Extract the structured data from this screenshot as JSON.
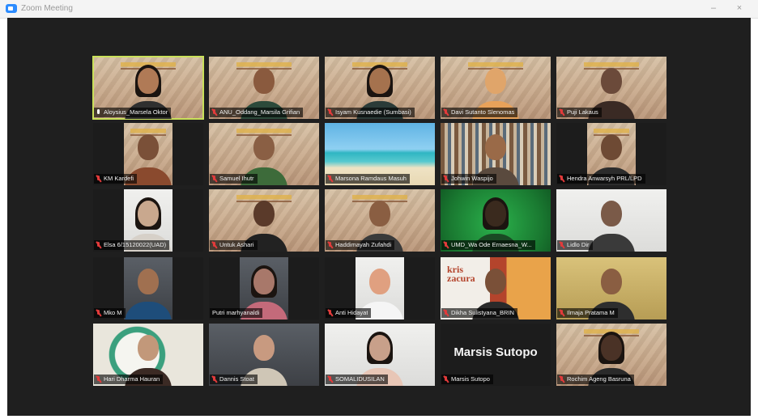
{
  "window": {
    "title": "Zoom Meeting",
    "minimize_label": "–",
    "close_label": "×"
  },
  "participants": [
    {
      "name": "Aloysius_Marsela Oktor",
      "mic": "on",
      "bg": "banner",
      "active": true,
      "skin": "#b07a56",
      "shirt": "#2f2f2f",
      "hair": true
    },
    {
      "name": "ANU_Oddang_Marsila Grifian",
      "mic": "muted",
      "bg": "banner",
      "skin": "#8a5a3e",
      "shirt": "#2c4a3a"
    },
    {
      "name": "Isyam Kusnaedie (Sumbasi)",
      "mic": "muted",
      "bg": "banner",
      "skin": "#a5724e",
      "shirt": "#2b3b38",
      "hair": true
    },
    {
      "name": "Davi Sutanto Slenomas",
      "mic": "muted",
      "bg": "banner",
      "skin": "#e0a56a",
      "shirt": "#e8a25a"
    },
    {
      "name": "Puji Lakaus",
      "mic": "muted",
      "bg": "banner",
      "skin": "#6b4a3a",
      "shirt": "#3a2a24"
    },
    {
      "name": "KM Kardefi",
      "mic": "muted",
      "bg": "banner-inset",
      "skin": "#7a5038",
      "shirt": "#8a4a2e"
    },
    {
      "name": "Samuel Ihutr",
      "mic": "muted",
      "bg": "banner",
      "skin": "#8a5f44",
      "shirt": "#3d6b3a"
    },
    {
      "name": "Marsona Ramdaus Masuh",
      "mic": "muted",
      "bg": "beach",
      "noperson": true
    },
    {
      "name": "Johwin Waspijo",
      "mic": "muted",
      "bg": "shelf",
      "skin": "#9a6a48",
      "shirt": "#5a4a3e"
    },
    {
      "name": "Hendra Anwarsyh PRL/LPD",
      "mic": "muted",
      "bg": "banner-inset",
      "skin": "#6e4a34",
      "shirt": "#2c2c2c"
    },
    {
      "name": "Elsa 6/15120022(UAD)",
      "mic": "muted",
      "bg": "white-inset",
      "skin": "#c9a88e",
      "shirt": "#d6d0c8",
      "hair": true
    },
    {
      "name": "Untuk Ashari",
      "mic": "muted",
      "bg": "banner",
      "skin": "#5a3a2a",
      "shirt": "#222222"
    },
    {
      "name": "Haddimayah Zufahdi",
      "mic": "muted",
      "bg": "banner",
      "skin": "#8a5e42",
      "shirt": "#3a3a3a"
    },
    {
      "name": "UMD_Wa Ode Ernaesna_W...",
      "mic": "muted",
      "bg": "green",
      "skin": "#3a2a1e",
      "shirt": "#1a4a24",
      "hair": true
    },
    {
      "name": "Lidlo Dir",
      "mic": "muted",
      "bg": "white",
      "skin": "#7a5a48",
      "shirt": "#3a3a3a"
    },
    {
      "name": "Mko M",
      "mic": "muted",
      "bg": "room-inset",
      "skin": "#a07050",
      "shirt": "#1e4d7a"
    },
    {
      "name": "Putri marhyanaldi",
      "mic": "none",
      "bg": "dark-inset",
      "skin": "#a8786a",
      "shirt": "#c46a7a",
      "hair": true
    },
    {
      "name": "Anti Hidayat",
      "mic": "muted",
      "bg": "white-inset",
      "skin": "#e0a080",
      "shirt": "#f5f5f5"
    },
    {
      "name": "Dikha Sulistyana_BRIN",
      "mic": "muted",
      "bg": "poster",
      "skin": "#7a5038",
      "shirt": "#2a2a2a"
    },
    {
      "name": "Ilmaja Pratama M",
      "mic": "muted",
      "bg": "yellow",
      "skin": "#8a5e42",
      "shirt": "#2e2e2e"
    },
    {
      "name": "Hari Dharma Hauran",
      "mic": "muted",
      "bg": "teal",
      "skin": "#c2987a",
      "shirt": "#3b2a24"
    },
    {
      "name": "Dannis Stoat",
      "mic": "muted",
      "bg": "room",
      "skin": "#c89a80",
      "shirt": "#cfc6b6"
    },
    {
      "name": "SOMALIDUSILAN",
      "mic": "muted",
      "bg": "white",
      "skin": "#c8a08a",
      "shirt": "#e8c6b6",
      "hair": true
    },
    {
      "name": "Marsis Sutopo",
      "mic": "muted",
      "bg": "dark",
      "noperson": true,
      "big_name": "Marsis Sutopo"
    },
    {
      "name": "Rochim Ageng Basruna",
      "mic": "muted",
      "bg": "banner",
      "skin": "#4a3226",
      "shirt": "#2a2a2a",
      "hair": true
    }
  ],
  "poster": {
    "title": "kris\nzacura"
  }
}
